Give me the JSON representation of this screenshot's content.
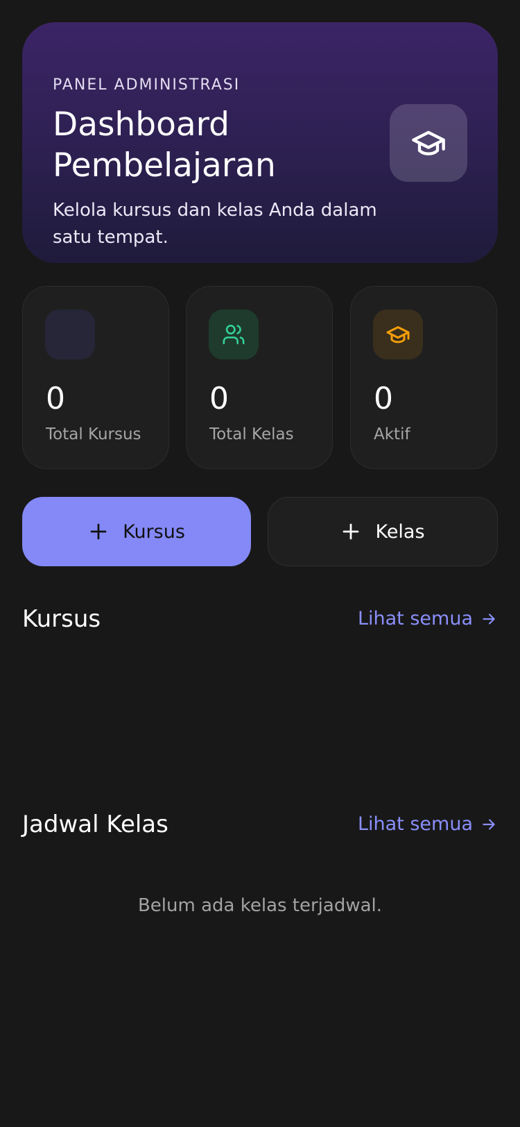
{
  "hero": {
    "eyebrow": "PANEL ADMINISTRASI",
    "title": "Dashboard Pembelajaran",
    "subtitle": "Kelola kursus dan kelas Anda dalam satu tempat.",
    "icon": "graduation-cap-icon"
  },
  "stats": [
    {
      "value": "0",
      "label": "Total Kursus",
      "icon": "book-icon",
      "color": "#262638"
    },
    {
      "value": "0",
      "label": "Total Kelas",
      "icon": "users-icon",
      "color": "#1e3b2e",
      "icon_color": "#34d399"
    },
    {
      "value": "0",
      "label": "Aktif",
      "icon": "graduation-cap-icon",
      "color": "#3a2f1c",
      "icon_color": "#f59e0b"
    }
  ],
  "actions": {
    "add_course": "Kursus",
    "add_class": "Kelas",
    "plus_icon": "plus-icon"
  },
  "courses_section": {
    "title": "Kursus",
    "link": "Lihat semua"
  },
  "schedule_section": {
    "title": "Jadwal Kelas",
    "link": "Lihat semua",
    "empty": "Belum ada kelas terjadwal."
  },
  "colors": {
    "background": "#181818",
    "accent": "#8489f7",
    "link": "#8a8ffa"
  }
}
